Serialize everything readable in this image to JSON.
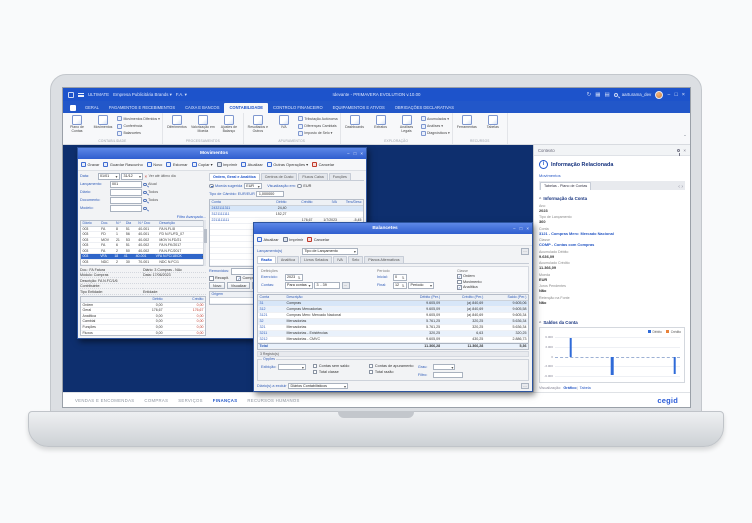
{
  "titlebar": {
    "workspace_label": "ULTIMATE",
    "company": "Empresa Publicitária Brands ▾",
    "branch": "F.A. ▾",
    "app_title": "Idevante - PRIMAVERA EVOLUTION v.10.00",
    "username": "aarturama_dev",
    "controls": {
      "minimize": "−",
      "maximize": "□",
      "close": "×"
    }
  },
  "ribbon_tabs": {
    "items": [
      "GERAL",
      "PAGAMENTOS E RECEBIMENTOS",
      "CAIXA E BANCOS",
      "CONTABILIDADE",
      "CONTROLO FINANCEIRO",
      "EQUIPAMENTOS E ATIVOS",
      "OBRIGAÇÕES DECLARATIVAS"
    ],
    "active": 3
  },
  "ribbon": {
    "groups": [
      {
        "name": "CONTABILIDADE",
        "big": [
          "Plano de Contas",
          "Movimentos"
        ],
        "stack": [
          "Movimentos Diferidos ▾",
          "Conferência",
          "Balancetes"
        ]
      },
      {
        "name": "PROCESSAMENTOS",
        "big": [
          "Diferimentos",
          "Valorização em Moeda",
          "Ajustes de Balanço"
        ],
        "stack": []
      },
      {
        "name": "APURAMENTOS",
        "big": [
          "Resultados e Outros",
          "IVA"
        ],
        "stack": [
          "Tributação Autónoma",
          "Diferenças Cambiais",
          "Imposto de Selo ▾"
        ]
      },
      {
        "name": "EXPLORAÇÃO",
        "big": [
          "Dashboards",
          "Extratos",
          "Análises Legais"
        ],
        "stack": [
          "Acumulados ▾",
          "Análises ▾",
          "Diagnósticos ▾"
        ]
      },
      {
        "name": "RECURSOS",
        "big": [
          "Ferramentas",
          "Tabelas"
        ],
        "stack": []
      }
    ],
    "collapse_glyph": "ˆ"
  },
  "movimentos": {
    "title": "Movimentos",
    "toolbar": [
      {
        "label": "Gravar",
        "icon": "save-icon"
      },
      {
        "label": "Guardar Rascunho",
        "icon": "draft-icon"
      },
      {
        "label": "Novo",
        "icon": "new-icon"
      },
      {
        "label": "Estornar",
        "icon": "revert-icon"
      },
      {
        "label": "Copiar ▾",
        "icon": "copy-icon"
      },
      {
        "label": "Imprimir",
        "icon": "print-icon"
      },
      {
        "label": "Atualizar",
        "icon": "refresh-icon"
      },
      {
        "label": "Outras Operações ▾",
        "icon": "gear-icon"
      },
      {
        "label": "Cancelar",
        "icon": "cancel-icon"
      }
    ],
    "fields": {
      "data_label": "Data:",
      "date_from": "01/01",
      "date_to": "31/12",
      "clear_glyph": "×",
      "date_hint": "Ver até último dia",
      "rows": [
        {
          "label": "Lançamento:",
          "value": "001",
          "suffix": "Atual"
        },
        {
          "label": "Diário:",
          "value": "",
          "suffix": "Todos"
        },
        {
          "label": "Documento:",
          "value": "",
          "suffix": "Todos"
        },
        {
          "label": "Modelo:",
          "value": "",
          "suffix": ""
        }
      ],
      "advanced_filter": "Filtro Avançado..."
    },
    "list": {
      "cols": [
        "Diário",
        "Doc.",
        "N.º",
        "Dia",
        "N.º Doc",
        "Descrição"
      ],
      "widths": [
        "15%",
        "12%",
        "8%",
        "10%",
        "17%",
        "38%"
      ],
      "rows": [
        [
          "003",
          "FA",
          "8",
          "51",
          "40-001",
          "FA N.FL/8"
        ],
        [
          "003",
          "FD",
          "1",
          "56",
          "40-001",
          "FD N.FL/FD_07"
        ],
        [
          "003",
          "MOV",
          "21",
          "53",
          "40-002",
          "MOV N.FD/21"
        ],
        [
          "003",
          "FA",
          "6",
          "51",
          "40-002",
          "FA N.FK/2017"
        ],
        [
          "003",
          "FA",
          "2",
          "50",
          "40-002",
          "FA N.FC/2017"
        ],
        [
          "003",
          "VFA",
          "18",
          "41",
          "40-001",
          "VFA N.FC/18/CK"
        ],
        [
          "003",
          "NDC",
          "2",
          "30",
          "70-001",
          "NDC N.FC/1"
        ]
      ],
      "selected": 5,
      "sel_class": "sel"
    },
    "detail_pairs": [
      [
        "Doc.: FA Fatura",
        "Diário: 3 Compras - NAc"
      ],
      [
        "Módulo: Compras",
        "Data: 17/06/2023"
      ],
      [
        "Descrição: FA N.FC/1/6",
        ""
      ],
      [
        "Contribuinte:",
        ""
      ],
      [
        "Tipo Entidade:",
        "Entidade:"
      ]
    ],
    "summary": {
      "cols": [
        "",
        "Débito",
        "Crédito"
      ],
      "widths": [
        "34%",
        "33%",
        "33%"
      ],
      "align": [
        "",
        "r",
        "r"
      ],
      "red_cols": [
        2
      ],
      "rows": [
        [
          "Ordem",
          "0,00",
          "0,00"
        ],
        [
          "Geral",
          "176,67",
          "176,67"
        ],
        [
          "Analítica",
          "0,00",
          "0,00"
        ],
        [
          "Cambial",
          "0,00",
          "0,00"
        ],
        [
          "Funções",
          "0,00",
          "0,00"
        ],
        [
          "Fluxos",
          "0,00",
          "0,00"
        ],
        [
          "Projetos",
          "0,00",
          "0,00"
        ]
      ]
    },
    "tabs": {
      "items": [
        "Ordem, Geral e Analítica",
        "Centros de Custo",
        "Fluxos Caixa",
        "Funções"
      ],
      "active": 0
    },
    "currency": {
      "radio1": "Moeda sugerida",
      "currency_value": "EUR",
      "view_label": "Visualização em:",
      "radio2": "EUR",
      "rate_label": "Tipo de Câmbio: EUR/EUR",
      "rate": "1,000000"
    },
    "doc_grid": {
      "cols": [
        "Conta",
        "Débito",
        "Crédito",
        "IVA",
        "Terc/Desc"
      ],
      "widths": [
        "34%",
        "17%",
        "17%",
        "16%",
        "16%"
      ],
      "align": [
        "",
        "r",
        "r",
        "r",
        "r"
      ],
      "rows": [
        [
          "2432111311",
          "24,40",
          "",
          "",
          ""
        ],
        [
          "3121111111",
          "152,27",
          "",
          "",
          ""
        ],
        [
          "2211111111",
          "",
          "176,67",
          "1/7/2023",
          "-5,45"
        ]
      ],
      "selected": 0,
      "sel_class": "sell",
      "empty_rows": 7,
      "first_col_blue": true
    },
    "footer": {
      "removidos_label": "Removidos:",
      "check1": "Recapit.",
      "check2": "Compras Merc",
      "buttons": [
        "Novo",
        "Visualizar",
        "Eliminar"
      ],
      "origem": {
        "cols": [
          "Origem",
          "Descrição"
        ],
        "widths": [
          "40%",
          "60%"
        ],
        "rows": [],
        "empty_rows": 1
      }
    }
  },
  "balancetes": {
    "title": "Balancetes",
    "toolbar": [
      {
        "label": "Atualizar",
        "icon": "refresh-icon"
      },
      {
        "label": "Imprimir",
        "icon": "print-icon"
      },
      {
        "label": "Cancelar",
        "icon": "cancel-icon"
      }
    ],
    "params": {
      "lancamentos_label": "Lançamento(s)",
      "tipo_value": "Tipo de Lançamento",
      "more": "…"
    },
    "tabs": {
      "items": [
        "Razão",
        "Analítica",
        "Livros Selados",
        "IVA",
        "Selo",
        "Planos Alternativos"
      ],
      "active": 0
    },
    "definicoes": {
      "heading": "Definições",
      "exercicio_label": "Exercício:",
      "exercicio": "2023",
      "contas_label": "Contas:",
      "contas_mode": "Para contas",
      "contas_value": "3 .. 39",
      "periodo_heading": "Período",
      "inicial_label": "Inicial:",
      "inicial": "0",
      "final_label": "Final:",
      "final": "12",
      "final_unit": "Período",
      "classe_heading": "Classe",
      "classe": [
        {
          "label": "Ordem",
          "checked": true
        },
        {
          "label": "Movimento",
          "checked": false
        },
        {
          "label": "Analítica",
          "checked": true
        }
      ]
    },
    "grid": {
      "cols": [
        "Conta",
        "Descrição",
        "Débito (Per.)",
        "Crédito (Per.)",
        "Saldo (Per.)"
      ],
      "widths": [
        "10%",
        "42%",
        "16%",
        "16%",
        "16%"
      ],
      "align": [
        "",
        "",
        "r",
        "r",
        "r"
      ],
      "zebra": true,
      "first_col_blue": true,
      "selected": 0,
      "sel_class": "sell",
      "total": 7,
      "rows": [
        [
          "31",
          "Compras",
          "9.605,09",
          "(a) 840,69",
          "9.605,06"
        ],
        [
          "312",
          "Compras Mercadorias",
          "9.605,09",
          "(a) 840,69",
          "9.605,58"
        ],
        [
          "3121",
          "Compras Merc: Mercado Nacional",
          "9.605,09",
          "(a) 840,69",
          "9.605,34"
        ],
        [
          "32",
          "Mercadorias",
          "5.761,25",
          "320,25",
          "5.636,34"
        ],
        [
          "321",
          "Mercadorias",
          "5.761,25",
          "320,25",
          "5.636,34"
        ],
        [
          "3211",
          "Mercadorias - Existências",
          "320,25",
          "6,63",
          "320,25"
        ],
        [
          "3212",
          "Mercadorias - CMVC",
          "9.605,09",
          "430,25",
          "2.886,73"
        ],
        [
          "Total",
          "",
          "11.366,28",
          "11.366,28",
          "5,36"
        ]
      ]
    },
    "status": "3 Registo(s)",
    "opcoes": {
      "heading": "Opções",
      "exibicao_label": "Exibição:",
      "checks": [
        {
          "label": "Contas sem saldo",
          "checked": false
        },
        {
          "label": "Contas de apuramento",
          "checked": false
        },
        {
          "label": "Total classe",
          "checked": false
        },
        {
          "label": "Total razão",
          "checked": false
        }
      ],
      "grau_label": "Grau:",
      "filtro_label": "Filtro:"
    },
    "exclude": {
      "label": "Diário(s) a excluir",
      "value": "Diários Contabilísticos",
      "more": "…"
    }
  },
  "context": {
    "header": "Contexto",
    "title": "Informação Relacionada",
    "link": "Movimentos",
    "tab": "Tabelas - Plano de Contas",
    "chevrons": "‹ ›",
    "section1": "Informação da Conta",
    "collapse_glyph": "^",
    "fields": [
      {
        "label": "Ano",
        "value": "2023"
      },
      {
        "label": "Tipo de Lançamento",
        "value": "360"
      },
      {
        "label": "Conta",
        "value": "3121 - Compras Merc: Mercado Nacional",
        "link": true
      },
      {
        "label": "Classe",
        "value": "COMP - Contas com Compras",
        "link": true
      },
      {
        "label": "Acumulado Débito",
        "value": "9.636,09"
      },
      {
        "label": "Acumulado Crédito",
        "value": "11.366,09"
      },
      {
        "label": "Moeda",
        "value": "EUR"
      },
      {
        "label": "Juros Pendentes",
        "value": "Não"
      },
      {
        "label": "Retenção na Fonte",
        "value": "Não"
      }
    ],
    "section2": "Saldos da Conta",
    "view_label": "Visualização:",
    "views": {
      "items": [
        "Gráfico",
        "Tabela"
      ],
      "active": 0
    }
  },
  "chart_data": {
    "type": "bar",
    "title": "Saldos da Conta",
    "x": [
      1,
      2,
      3,
      4,
      5,
      6,
      7,
      8,
      9,
      10,
      11,
      12
    ],
    "xlabel": "",
    "ylabel": "",
    "ylim": [
      -6000,
      6000
    ],
    "yticks": [
      "6.000",
      "3.000",
      "0",
      "-3.000",
      "-6.000"
    ],
    "grid": true,
    "legend_position": "top-right",
    "series": [
      {
        "name": "Débito",
        "color": "#2f6bd8",
        "values": [
          0,
          5800,
          0,
          0,
          0,
          -5600,
          0,
          0,
          0,
          0,
          0,
          -5400
        ]
      },
      {
        "name": "Crédito",
        "color": "#e8823a",
        "values": [
          0,
          0,
          0,
          0,
          0,
          0,
          0,
          0,
          0,
          0,
          0,
          0
        ]
      }
    ]
  },
  "bottom_nav": {
    "items": [
      "VENDAS E ENCOMENDAS",
      "COMPRAS",
      "SERVIÇOS",
      "FINANÇAS",
      "RECURSOS HUMANOS"
    ],
    "active": 3,
    "logo": "cegid"
  }
}
